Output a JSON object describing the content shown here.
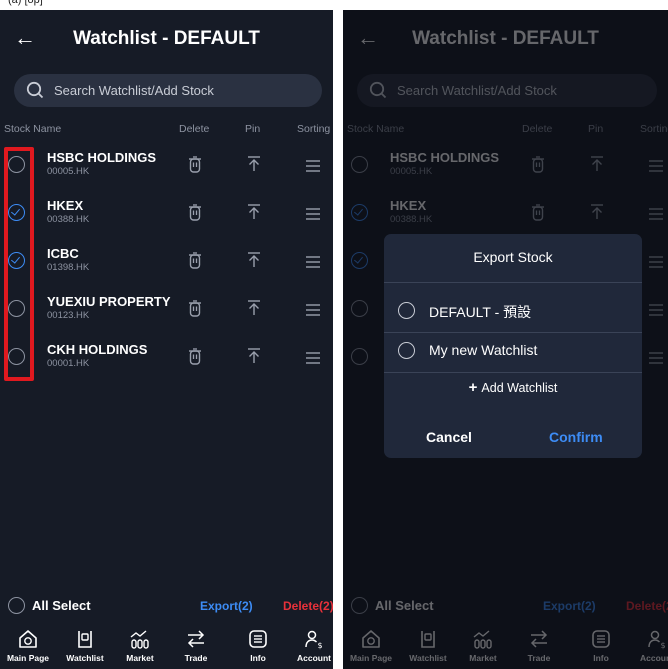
{
  "caption": "(a)              [op]",
  "colors": {
    "accent": "#3d8cf5",
    "danger": "#e8313a",
    "highlight": "#e0191f",
    "background": "#161b26"
  },
  "screen": {
    "back_icon": "arrow-left-icon",
    "title": "Watchlist - DEFAULT",
    "search_placeholder": "Search Watchlist/Add Stock",
    "columns": {
      "name": "Stock Name",
      "delete": "Delete",
      "pin": "Pin",
      "sorting": "Sorting"
    },
    "stocks": [
      {
        "name": "HSBC HOLDINGS",
        "code": "00005.HK",
        "selected": false
      },
      {
        "name": "HKEX",
        "code": "00388.HK",
        "selected": true
      },
      {
        "name": "ICBC",
        "code": "01398.HK",
        "selected": true
      },
      {
        "name": "YUEXIU PROPERTY",
        "code": "00123.HK",
        "selected": false
      },
      {
        "name": "CKH HOLDINGS",
        "code": "00001.HK",
        "selected": false
      }
    ],
    "select_all": "All Select",
    "export": "Export(2)",
    "delete": "Delete(2)",
    "nav": [
      {
        "label": "Main Page",
        "icon": "home-icon"
      },
      {
        "label": "Watchlist",
        "icon": "watchlist-icon"
      },
      {
        "label": "Market",
        "icon": "market-icon"
      },
      {
        "label": "Trade",
        "icon": "trade-icon"
      },
      {
        "label": "Info",
        "icon": "info-icon"
      },
      {
        "label": "Account",
        "icon": "account-icon"
      }
    ]
  },
  "dialog": {
    "title": "Export Stock",
    "options": [
      {
        "label": "DEFAULT - 預設"
      },
      {
        "label": "My new Watchlist"
      }
    ],
    "add_watchlist": "Add Watchlist",
    "cancel": "Cancel",
    "confirm": "Confirm"
  }
}
